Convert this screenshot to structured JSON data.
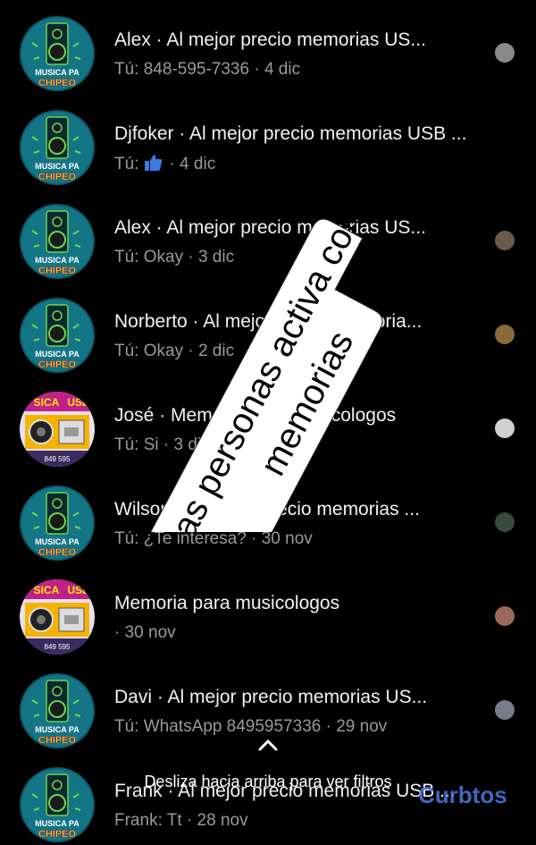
{
  "conversations": [
    {
      "name": "Alex",
      "title": "Alex · Al mejor precio memorias US...",
      "subtitle": "Tú: 848-595-7336 · 4 dic",
      "avatar": "musica-pa-chipeo-speaker-logo",
      "avatar_text": "MUSICA PA CHIPEO",
      "seen_color": "#8a8a8a"
    },
    {
      "name": "Djfoker",
      "title": "Djfoker · Al mejor precio memorias USB ...",
      "subtitle_prefix": "Tú:",
      "subtitle_icon": "thumbs-up-icon",
      "subtitle_suffix": "· 4 dic",
      "avatar": "musica-pa-chipeo-speaker-logo",
      "avatar_text": "MUSICA PA CHIPEO"
    },
    {
      "name": "Alex",
      "title": "Alex · Al mejor precio memorias US...",
      "subtitle": "Tú: Okay · 3 dic",
      "avatar": "musica-pa-chipeo-speaker-logo",
      "avatar_text": "MUSICA PA CHIPEO",
      "seen_color": "#6b5a4a"
    },
    {
      "name": "Norberto",
      "title": "Norberto · Al mejor precio memoria...",
      "subtitle": "Tú: Okay · 2 dic",
      "avatar": "musica-pa-chipeo-speaker-logo",
      "avatar_text": "MUSICA PA CHIPEO",
      "seen_color": "#8a6a3a"
    },
    {
      "name": "José",
      "title": "José · Memoria para musicologos",
      "subtitle": "Tú: Si · 3 dic",
      "avatar": "musica-usb-colorful-logo",
      "avatar_text": "MUSICA USB",
      "seen_color": "#d0d0d0"
    },
    {
      "name": "Wilson",
      "title": "Wilson · Al mejor precio memorias ...",
      "subtitle": "Tú: ¿Te interesa? · 30 nov",
      "avatar": "musica-pa-chipeo-speaker-logo",
      "avatar_text": "MUSICA PA CHIPEO",
      "seen_color": "#3a4a3a"
    },
    {
      "name": "",
      "title": "Memoria para musicologos",
      "subtitle": "· 30 nov",
      "avatar": "musica-usb-colorful-logo",
      "avatar_text": "MUSICA USB",
      "seen_color": "#9a6a5a"
    },
    {
      "name": "Davi",
      "title": "Davi · Al mejor precio memorias US...",
      "subtitle": "Tú: WhatsApp 8495957336 · 29 nov",
      "avatar": "musica-pa-chipeo-speaker-logo",
      "avatar_text": "MUSICA PA CHIPEO",
      "seen_color": "#7a7a8a"
    },
    {
      "name": "Frank",
      "title": "Frank · Al mejor precio memorias USB ...",
      "subtitle": "Frank: Tt · 28 nov",
      "avatar": "musica-pa-chipeo-speaker-logo",
      "avatar_text": "MUSICA PA CHIPEO"
    }
  ],
  "overlay": {
    "line1": "Las personas activa con sus",
    "line2": "memorias",
    "background": "#ffffff",
    "text_color": "#000000"
  },
  "footer": {
    "hint": "Desliza hacia arriba para ver filtros",
    "chevron": "chevron-up-icon",
    "watermark": "Curbtos"
  },
  "colors": {
    "background": "#000000",
    "title": "#f2f2f2",
    "subtitle": "#9a9a9a",
    "logo_teal": "#1a8f8f",
    "logo_green": "#6fd34f",
    "like_blue": "#3b7be0"
  }
}
